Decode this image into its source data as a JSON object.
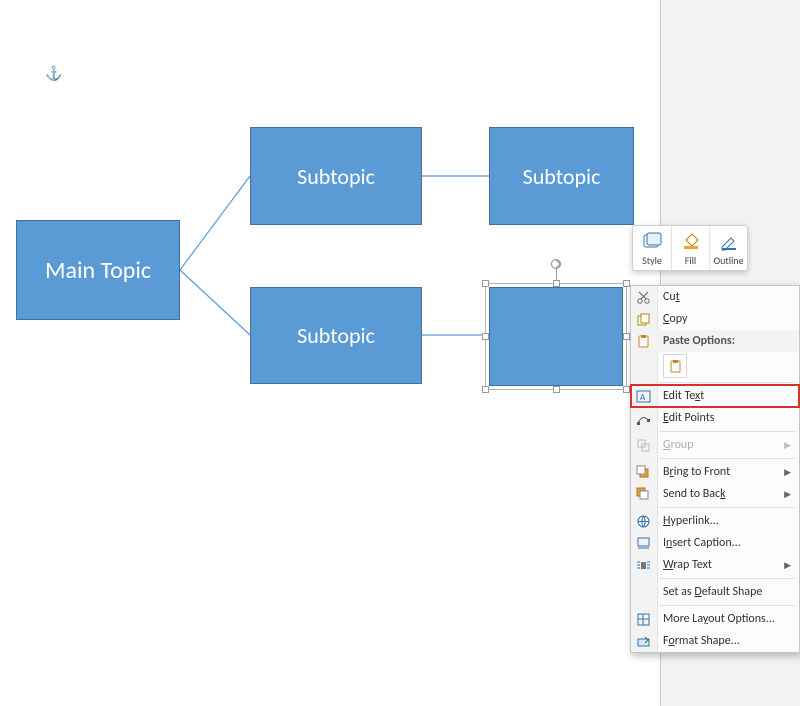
{
  "anchor_glyph": "⚓",
  "shapes": {
    "main": {
      "label": "Main Topic"
    },
    "sub_tl": {
      "label": "Subtopic"
    },
    "sub_tr": {
      "label": "Subtopic"
    },
    "sub_bl": {
      "label": "Subtopic"
    },
    "sub_br": {
      "label": ""
    }
  },
  "mini_toolbar": {
    "style": "Style",
    "fill": "Fill",
    "outline": "Outline"
  },
  "context_menu": {
    "cut": {
      "pre": "Cu",
      "u": "t",
      "post": ""
    },
    "copy": {
      "pre": "",
      "u": "C",
      "post": "opy"
    },
    "paste_options": "Paste Options:",
    "edit_text": {
      "pre": "Edit Te",
      "u": "x",
      "post": "t"
    },
    "edit_points": {
      "pre": "",
      "u": "E",
      "post": "dit Points"
    },
    "group": {
      "pre": "",
      "u": "G",
      "post": "roup"
    },
    "bring_front": {
      "pre": "B",
      "u": "r",
      "post": "ing to Front"
    },
    "send_back": {
      "pre": "Send to Bac",
      "u": "k",
      "post": ""
    },
    "hyperlink": {
      "pre": "",
      "u": "H",
      "post": "yperlink..."
    },
    "insert_caption": {
      "pre": "I",
      "u": "n",
      "post": "sert Caption..."
    },
    "wrap_text": {
      "pre": "",
      "u": "W",
      "post": "rap Text"
    },
    "set_default": {
      "pre": "Set as ",
      "u": "D",
      "post": "efault Shape"
    },
    "more_layout": {
      "pre": "More La",
      "u": "y",
      "post": "out Options..."
    },
    "format_shape": {
      "pre": "F",
      "u": "o",
      "post": "rmat Shape..."
    }
  }
}
